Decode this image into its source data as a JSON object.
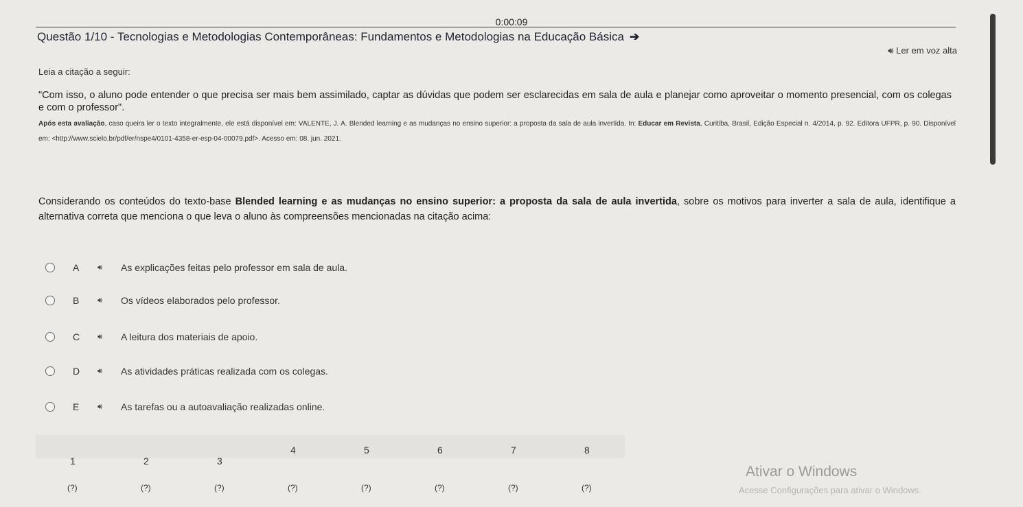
{
  "timer": "0:00:09",
  "question": {
    "title": "Questão 1/10 - Tecnologias e Metodologias Contemporâneas: Fundamentos e Metodologias na Educação Básica",
    "next_arrow": "➔",
    "read_aloud": "Ler em voz alta",
    "intro": "Leia a citação a seguir:",
    "quote": "\"Com isso, o aluno pode entender o que precisa ser mais bem assimilado, captar as dúvidas que podem ser esclarecidas em sala de aula e planejar como aproveitar o momento presencial, com os colegas e com o professor\".",
    "ref_bold": "Após esta avaliação",
    "ref_text": ", caso queira ler o texto integralmente, ele está disponível em: VALENTE, J. A. Blended learning e as mudanças no ensino superior: a proposta da sala de aula invertida. In: ",
    "ref_bold2": "Educar em Revista",
    "ref_text2": ", Curitiba, Brasil, Edição Especial n. 4/2014, p. 92. Editora UFPR, p. 90. Disponível em: <http://www.scielo.br/pdf/er/nspe4/0101-4358-er-esp-04-00079.pdf>. Acesso em: 08. jun. 2021.",
    "prompt_a": "Considerando os conteúdos do texto-base ",
    "prompt_bold": "Blended learning e as mudanças no ensino superior: a proposta da sala de aula invertida",
    "prompt_b": ", sobre os motivos para inverter a sala de aula, identifique a alternativa correta que menciona o que leva o aluno às compreensões mencionadas na citação acima:"
  },
  "options": [
    {
      "letter": "A",
      "text": "As explicações feitas pelo professor em sala de aula."
    },
    {
      "letter": "B",
      "text": "Os vídeos elaborados pelo professor."
    },
    {
      "letter": "C",
      "text": "A leitura dos materiais de apoio."
    },
    {
      "letter": "D",
      "text": "As atividades práticas realizada com os colegas."
    },
    {
      "letter": "E",
      "text": "As tarefas ou a autoavaliação realizadas online."
    }
  ],
  "speaker_icon": "speaker-icon",
  "navigation": [
    {
      "num": "1",
      "status": "(?)"
    },
    {
      "num": "2",
      "status": "(?)"
    },
    {
      "num": "3",
      "status": "(?)"
    },
    {
      "num": "4",
      "status": "(?)"
    },
    {
      "num": "5",
      "status": "(?)"
    },
    {
      "num": "6",
      "status": "(?)"
    },
    {
      "num": "7",
      "status": "(?)"
    },
    {
      "num": "8",
      "status": "(?)"
    }
  ],
  "watermark": {
    "title": "Ativar o Windows",
    "sub": "Acesse Configurações para ativar o Windows."
  }
}
